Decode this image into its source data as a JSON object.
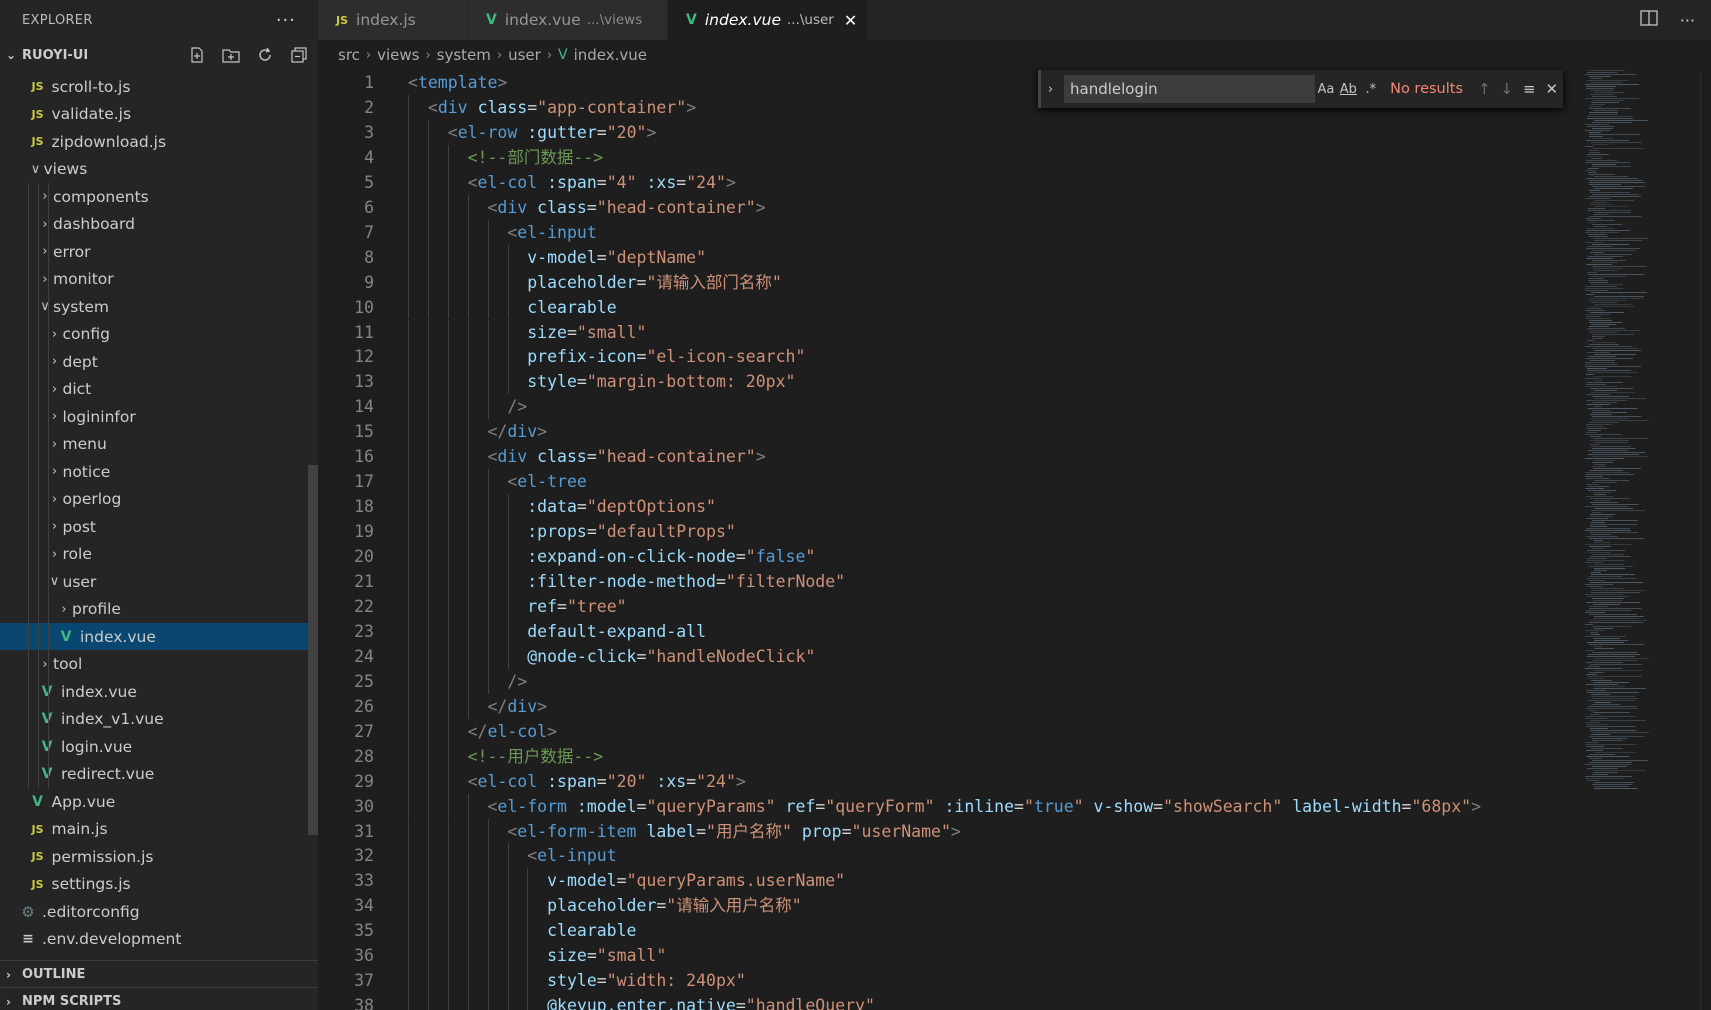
{
  "sidebar": {
    "title": "EXPLORER",
    "more": "···",
    "project": "RUOYI-UI",
    "tree": [
      {
        "label": "scroll-to.js",
        "icon": "js",
        "depth": 2
      },
      {
        "label": "validate.js",
        "icon": "js",
        "depth": 2
      },
      {
        "label": "zipdownload.js",
        "icon": "js",
        "depth": 2
      },
      {
        "label": "views",
        "icon": "folder-open",
        "depth": 2
      },
      {
        "label": "components",
        "icon": "folder",
        "depth": 3
      },
      {
        "label": "dashboard",
        "icon": "folder",
        "depth": 3
      },
      {
        "label": "error",
        "icon": "folder",
        "depth": 3
      },
      {
        "label": "monitor",
        "icon": "folder",
        "depth": 3
      },
      {
        "label": "system",
        "icon": "folder-open",
        "depth": 3
      },
      {
        "label": "config",
        "icon": "folder",
        "depth": 4
      },
      {
        "label": "dept",
        "icon": "folder",
        "depth": 4
      },
      {
        "label": "dict",
        "icon": "folder",
        "depth": 4
      },
      {
        "label": "logininfor",
        "icon": "folder",
        "depth": 4
      },
      {
        "label": "menu",
        "icon": "folder",
        "depth": 4
      },
      {
        "label": "notice",
        "icon": "folder",
        "depth": 4
      },
      {
        "label": "operlog",
        "icon": "folder",
        "depth": 4
      },
      {
        "label": "post",
        "icon": "folder",
        "depth": 4
      },
      {
        "label": "role",
        "icon": "folder",
        "depth": 4
      },
      {
        "label": "user",
        "icon": "folder-open",
        "depth": 4
      },
      {
        "label": "profile",
        "icon": "folder",
        "depth": 5
      },
      {
        "label": "index.vue",
        "icon": "vue",
        "depth": 5,
        "selected": true
      },
      {
        "label": "tool",
        "icon": "folder",
        "depth": 3
      },
      {
        "label": "index.vue",
        "icon": "vue",
        "depth": 3
      },
      {
        "label": "index_v1.vue",
        "icon": "vue",
        "depth": 3
      },
      {
        "label": "login.vue",
        "icon": "vue",
        "depth": 3
      },
      {
        "label": "redirect.vue",
        "icon": "vue",
        "depth": 3
      },
      {
        "label": "App.vue",
        "icon": "vue",
        "depth": 2
      },
      {
        "label": "main.js",
        "icon": "js",
        "depth": 2
      },
      {
        "label": "permission.js",
        "icon": "js",
        "depth": 2
      },
      {
        "label": "settings.js",
        "icon": "js",
        "depth": 2
      },
      {
        "label": ".editorconfig",
        "icon": "gear",
        "depth": 1
      },
      {
        "label": ".env.development",
        "icon": "lines",
        "depth": 1
      }
    ],
    "sections": [
      "OUTLINE",
      "NPM SCRIPTS"
    ]
  },
  "tabs": [
    {
      "icon": "JS",
      "label": "index.js",
      "desc": "",
      "active": false
    },
    {
      "icon": "V",
      "label": "index.vue",
      "desc": "...\\views",
      "active": false
    },
    {
      "icon": "V",
      "label": "index.vue",
      "desc": "...\\user",
      "active": true
    }
  ],
  "breadcrumb": [
    "src",
    "views",
    "system",
    "user",
    "index.vue"
  ],
  "find": {
    "query": "handlelogin",
    "case": "Aa",
    "word": "Ab",
    "regex": ".*",
    "status": "No results"
  },
  "code": [
    [
      [
        "p",
        "<"
      ],
      [
        "t",
        "template"
      ],
      [
        "p",
        ">"
      ]
    ],
    [
      [
        "s",
        "  "
      ],
      [
        "p",
        "<"
      ],
      [
        "t",
        "div"
      ],
      [
        "s",
        " "
      ],
      [
        "a",
        "class"
      ],
      [
        "s",
        "="
      ],
      [
        "q",
        "\"app-container\""
      ],
      [
        "p",
        ">"
      ]
    ],
    [
      [
        "s",
        "    "
      ],
      [
        "p",
        "<"
      ],
      [
        "t",
        "el-row"
      ],
      [
        "s",
        " "
      ],
      [
        "a",
        ":gutter"
      ],
      [
        "s",
        "="
      ],
      [
        "q",
        "\"20\""
      ],
      [
        "p",
        ">"
      ]
    ],
    [
      [
        "s",
        "      "
      ],
      [
        "c",
        "<!--部门数据-->"
      ]
    ],
    [
      [
        "s",
        "      "
      ],
      [
        "p",
        "<"
      ],
      [
        "t",
        "el-col"
      ],
      [
        "s",
        " "
      ],
      [
        "a",
        ":span"
      ],
      [
        "s",
        "="
      ],
      [
        "q",
        "\"4\""
      ],
      [
        "s",
        " "
      ],
      [
        "a",
        ":xs"
      ],
      [
        "s",
        "="
      ],
      [
        "q",
        "\"24\""
      ],
      [
        "p",
        ">"
      ]
    ],
    [
      [
        "s",
        "        "
      ],
      [
        "p",
        "<"
      ],
      [
        "t",
        "div"
      ],
      [
        "s",
        " "
      ],
      [
        "a",
        "class"
      ],
      [
        "s",
        "="
      ],
      [
        "q",
        "\"head-container\""
      ],
      [
        "p",
        ">"
      ]
    ],
    [
      [
        "s",
        "          "
      ],
      [
        "p",
        "<"
      ],
      [
        "t",
        "el-input"
      ]
    ],
    [
      [
        "s",
        "            "
      ],
      [
        "a",
        "v-model"
      ],
      [
        "s",
        "="
      ],
      [
        "q",
        "\"deptName\""
      ]
    ],
    [
      [
        "s",
        "            "
      ],
      [
        "a",
        "placeholder"
      ],
      [
        "s",
        "="
      ],
      [
        "q",
        "\"请输入部门名称\""
      ]
    ],
    [
      [
        "s",
        "            "
      ],
      [
        "a",
        "clearable"
      ]
    ],
    [
      [
        "s",
        "            "
      ],
      [
        "a",
        "size"
      ],
      [
        "s",
        "="
      ],
      [
        "q",
        "\"small\""
      ]
    ],
    [
      [
        "s",
        "            "
      ],
      [
        "a",
        "prefix-icon"
      ],
      [
        "s",
        "="
      ],
      [
        "q",
        "\"el-icon-search\""
      ]
    ],
    [
      [
        "s",
        "            "
      ],
      [
        "a",
        "style"
      ],
      [
        "s",
        "="
      ],
      [
        "q",
        "\"margin-bottom: 20px\""
      ]
    ],
    [
      [
        "s",
        "          "
      ],
      [
        "p",
        "/>"
      ]
    ],
    [
      [
        "s",
        "        "
      ],
      [
        "p",
        "</"
      ],
      [
        "t",
        "div"
      ],
      [
        "p",
        ">"
      ]
    ],
    [
      [
        "s",
        "        "
      ],
      [
        "p",
        "<"
      ],
      [
        "t",
        "div"
      ],
      [
        "s",
        " "
      ],
      [
        "a",
        "class"
      ],
      [
        "s",
        "="
      ],
      [
        "q",
        "\"head-container\""
      ],
      [
        "p",
        ">"
      ]
    ],
    [
      [
        "s",
        "          "
      ],
      [
        "p",
        "<"
      ],
      [
        "t",
        "el-tree"
      ]
    ],
    [
      [
        "s",
        "            "
      ],
      [
        "a",
        ":data"
      ],
      [
        "s",
        "="
      ],
      [
        "q",
        "\"deptOptions\""
      ]
    ],
    [
      [
        "s",
        "            "
      ],
      [
        "a",
        ":props"
      ],
      [
        "s",
        "="
      ],
      [
        "q",
        "\"defaultProps\""
      ]
    ],
    [
      [
        "s",
        "            "
      ],
      [
        "a",
        ":expand-on-click-node"
      ],
      [
        "s",
        "="
      ],
      [
        "q",
        "\""
      ],
      [
        "k",
        "false"
      ],
      [
        "q",
        "\""
      ]
    ],
    [
      [
        "s",
        "            "
      ],
      [
        "a",
        ":filter-node-method"
      ],
      [
        "s",
        "="
      ],
      [
        "q",
        "\"filterNode\""
      ]
    ],
    [
      [
        "s",
        "            "
      ],
      [
        "a",
        "ref"
      ],
      [
        "s",
        "="
      ],
      [
        "q",
        "\"tree\""
      ]
    ],
    [
      [
        "s",
        "            "
      ],
      [
        "a",
        "default-expand-all"
      ]
    ],
    [
      [
        "s",
        "            "
      ],
      [
        "a",
        "@node-click"
      ],
      [
        "s",
        "="
      ],
      [
        "q",
        "\"handleNodeClick\""
      ]
    ],
    [
      [
        "s",
        "          "
      ],
      [
        "p",
        "/>"
      ]
    ],
    [
      [
        "s",
        "        "
      ],
      [
        "p",
        "</"
      ],
      [
        "t",
        "div"
      ],
      [
        "p",
        ">"
      ]
    ],
    [
      [
        "s",
        "      "
      ],
      [
        "p",
        "</"
      ],
      [
        "t",
        "el-col"
      ],
      [
        "p",
        ">"
      ]
    ],
    [
      [
        "s",
        "      "
      ],
      [
        "c",
        "<!--用户数据-->"
      ]
    ],
    [
      [
        "s",
        "      "
      ],
      [
        "p",
        "<"
      ],
      [
        "t",
        "el-col"
      ],
      [
        "s",
        " "
      ],
      [
        "a",
        ":span"
      ],
      [
        "s",
        "="
      ],
      [
        "q",
        "\"20\""
      ],
      [
        "s",
        " "
      ],
      [
        "a",
        ":xs"
      ],
      [
        "s",
        "="
      ],
      [
        "q",
        "\"24\""
      ],
      [
        "p",
        ">"
      ]
    ],
    [
      [
        "s",
        "        "
      ],
      [
        "p",
        "<"
      ],
      [
        "t",
        "el-form"
      ],
      [
        "s",
        " "
      ],
      [
        "a",
        ":model"
      ],
      [
        "s",
        "="
      ],
      [
        "q",
        "\"queryParams\""
      ],
      [
        "s",
        " "
      ],
      [
        "a",
        "ref"
      ],
      [
        "s",
        "="
      ],
      [
        "q",
        "\"queryForm\""
      ],
      [
        "s",
        " "
      ],
      [
        "a",
        ":inline"
      ],
      [
        "s",
        "="
      ],
      [
        "q",
        "\""
      ],
      [
        "k",
        "true"
      ],
      [
        "q",
        "\""
      ],
      [
        "s",
        " "
      ],
      [
        "a",
        "v-show"
      ],
      [
        "s",
        "="
      ],
      [
        "q",
        "\"showSearch\""
      ],
      [
        "s",
        " "
      ],
      [
        "a",
        "label-width"
      ],
      [
        "s",
        "="
      ],
      [
        "q",
        "\"68px\""
      ],
      [
        "p",
        ">"
      ]
    ],
    [
      [
        "s",
        "          "
      ],
      [
        "p",
        "<"
      ],
      [
        "t",
        "el-form-item"
      ],
      [
        "s",
        " "
      ],
      [
        "a",
        "label"
      ],
      [
        "s",
        "="
      ],
      [
        "q",
        "\"用户名称\""
      ],
      [
        "s",
        " "
      ],
      [
        "a",
        "prop"
      ],
      [
        "s",
        "="
      ],
      [
        "q",
        "\"userName\""
      ],
      [
        "p",
        ">"
      ]
    ],
    [
      [
        "s",
        "            "
      ],
      [
        "p",
        "<"
      ],
      [
        "t",
        "el-input"
      ]
    ],
    [
      [
        "s",
        "              "
      ],
      [
        "a",
        "v-model"
      ],
      [
        "s",
        "="
      ],
      [
        "q",
        "\"queryParams.userName\""
      ]
    ],
    [
      [
        "s",
        "              "
      ],
      [
        "a",
        "placeholder"
      ],
      [
        "s",
        "="
      ],
      [
        "q",
        "\"请输入用户名称\""
      ]
    ],
    [
      [
        "s",
        "              "
      ],
      [
        "a",
        "clearable"
      ]
    ],
    [
      [
        "s",
        "              "
      ],
      [
        "a",
        "size"
      ],
      [
        "s",
        "="
      ],
      [
        "q",
        "\"small\""
      ]
    ],
    [
      [
        "s",
        "              "
      ],
      [
        "a",
        "style"
      ],
      [
        "s",
        "="
      ],
      [
        "q",
        "\"width: 240px\""
      ]
    ],
    [
      [
        "s",
        "              "
      ],
      [
        "a",
        "@keyup.enter.native"
      ],
      [
        "s",
        "="
      ],
      [
        "q",
        "\"handleQuery\""
      ]
    ]
  ]
}
